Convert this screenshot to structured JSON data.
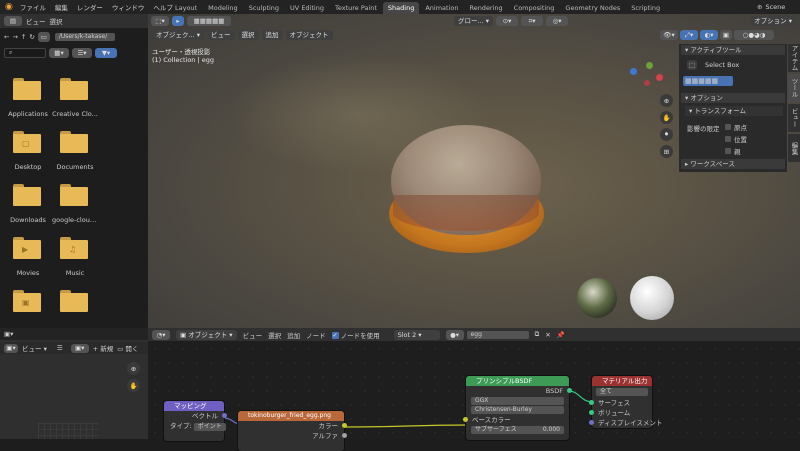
{
  "menu": {
    "items": [
      "ファイル",
      "編集",
      "レンダー",
      "ウィンドウ",
      "ヘルプ"
    ],
    "scene": "Scene"
  },
  "workspace_tabs": [
    {
      "label": "Layout",
      "active": false
    },
    {
      "label": "Modeling",
      "active": false
    },
    {
      "label": "Sculpting",
      "active": false
    },
    {
      "label": "UV Editing",
      "active": false
    },
    {
      "label": "Texture Paint",
      "active": false
    },
    {
      "label": "Shading",
      "active": true
    },
    {
      "label": "Animation",
      "active": false
    },
    {
      "label": "Rendering",
      "active": false
    },
    {
      "label": "Compositing",
      "active": false
    },
    {
      "label": "Geometry Nodes",
      "active": false
    },
    {
      "label": "Scripting",
      "active": false
    }
  ],
  "file_browser": {
    "header": [
      "ビュー",
      "選択"
    ],
    "path": "/Users/k-takase/",
    "items": [
      {
        "label": "Applications"
      },
      {
        "label": "Creative Clo..."
      },
      {
        "label": "Desktop"
      },
      {
        "label": "Documents"
      },
      {
        "label": "Downloads"
      },
      {
        "label": "google-cloud..."
      },
      {
        "label": "Movies",
        "glyph": "▶"
      },
      {
        "label": "Music",
        "glyph": "♫"
      },
      {
        "label": "",
        "glyph": "▣"
      },
      {
        "label": ""
      }
    ]
  },
  "viewport": {
    "mode": "オブジェク...",
    "menus": [
      "ビュー",
      "選択",
      "追加",
      "オブジェクト"
    ],
    "view_name": "ユーザー・透視投影",
    "collection": "(1) Collection | egg",
    "orientation": "グロー...",
    "options": "オプション"
  },
  "npanel": {
    "active_tool_title": "アクティブツール",
    "tool": "Select Box",
    "options_title": "オプション",
    "transform_title": "トランスフォーム",
    "affect_only": "影響の限定",
    "checks": [
      "原点",
      "位置",
      "親"
    ],
    "workspace_title": "ワークスペース",
    "tabs": [
      "アイテム",
      "ツール",
      "ビュー",
      "編集"
    ]
  },
  "node_editor": {
    "mode": "オブジェクト",
    "menus": [
      "ビュー",
      "選択",
      "追加",
      "ノード"
    ],
    "use_nodes": "ノードを使用",
    "slot": "Slot 2",
    "material": "egg"
  },
  "image_editor": {
    "view": "ビュー",
    "new": "新規",
    "open": "開く"
  },
  "nodes": {
    "mapping": {
      "title": "マッピング",
      "vector": "ベクトル",
      "type_label": "タイプ:",
      "type": "ポイント"
    },
    "image": {
      "title": "tokinoburger_fried_egg.png",
      "color": "カラー",
      "alpha": "アルファ"
    },
    "bsdf": {
      "title": "プリンシプルBSDF",
      "out": "BSDF",
      "dist": "GGX",
      "sss": "Christensen-Burley",
      "base": "ベースカラー",
      "sub": "サブサーフェス",
      "sub_val": "0.000"
    },
    "output": {
      "title": "マテリアル出力",
      "target": "全て",
      "rows": [
        "サーフェス",
        "ボリューム",
        "ディスプレイスメント"
      ]
    }
  },
  "colors": {
    "accent": "#4772b3",
    "active_tab": "#474747",
    "mapping": "#6f5fc2",
    "image": "#b9683b",
    "bsdf": "#3d9b56",
    "output": "#9c3131"
  }
}
